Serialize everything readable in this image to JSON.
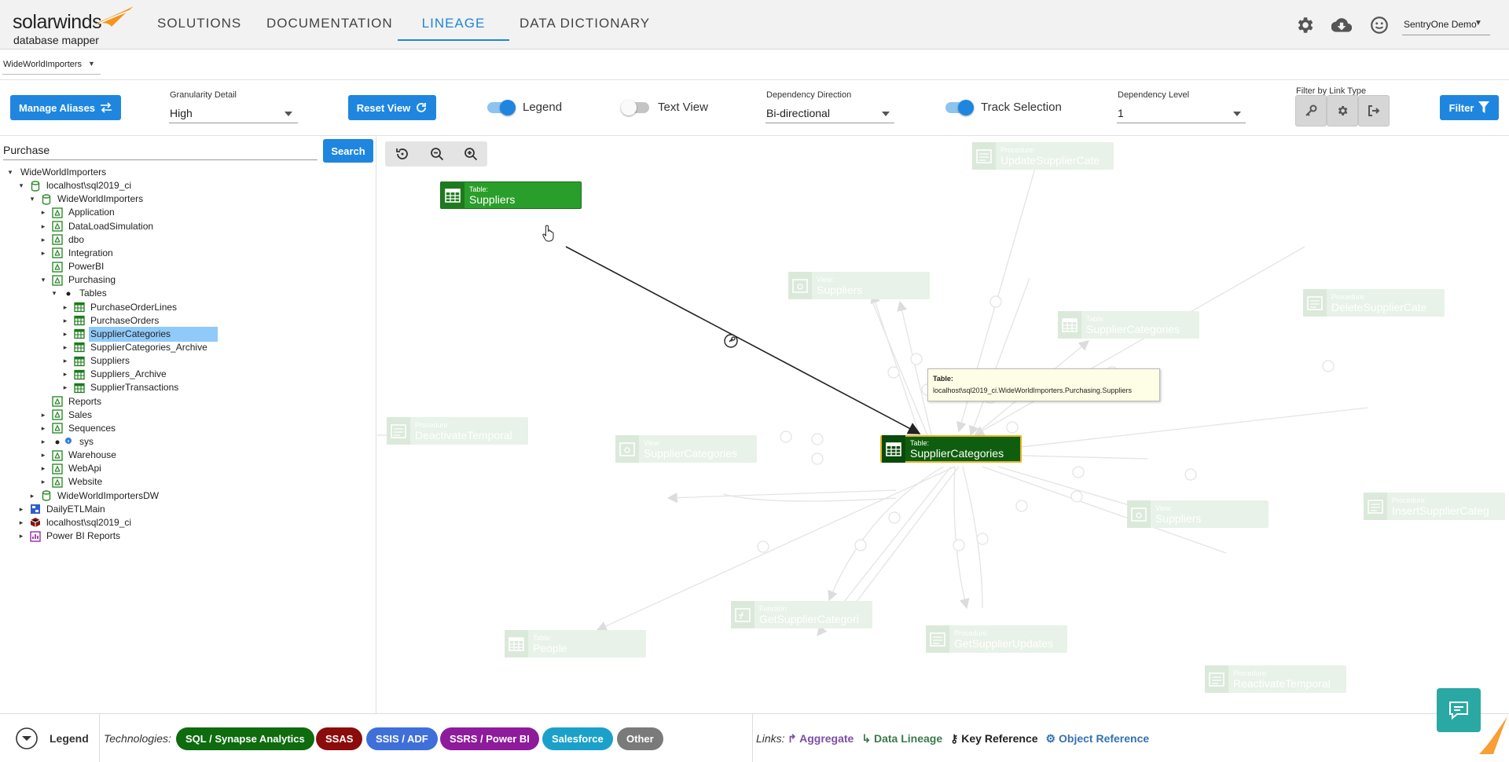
{
  "header": {
    "logo_word": "solarwinds",
    "logo_sub": "database mapper",
    "nav": [
      "SOLUTIONS",
      "DOCUMENTATION",
      "LINEAGE",
      "DATA DICTIONARY"
    ],
    "active_nav": "LINEAGE",
    "user": "SentryOne Demo",
    "icons": [
      "gear-icon",
      "cloud-download-icon",
      "smiley-icon"
    ]
  },
  "database_selector": {
    "value": "WideWorldImporters"
  },
  "toolbar": {
    "manage_aliases": "Manage Aliases",
    "granularity_label": "Granularity Detail",
    "granularity_value": "High",
    "reset_view": "Reset View",
    "legend_label": "Legend",
    "legend_on": true,
    "text_view_label": "Text View",
    "text_view_on": false,
    "dependency_direction_label": "Dependency Direction",
    "dependency_direction_value": "Bi-directional",
    "track_selection_label": "Track Selection",
    "track_selection_on": true,
    "dependency_level_label": "Dependency Level",
    "dependency_level_value": "1",
    "filter_link_type_label": "Filter by Link Type",
    "filter_button": "Filter",
    "accent_color": "#1f86e0"
  },
  "search": {
    "value": "Purchase",
    "button": "Search"
  },
  "tree": [
    {
      "label": "WideWorldImporters",
      "depth": 0,
      "toggle": "open",
      "icon": "none"
    },
    {
      "label": "localhost\\sql2019_ci",
      "depth": 1,
      "toggle": "open",
      "icon": "db-green"
    },
    {
      "label": "WideWorldImporters",
      "depth": 2,
      "toggle": "open",
      "icon": "db-green"
    },
    {
      "label": "Application",
      "depth": 3,
      "toggle": "closed",
      "icon": "schema"
    },
    {
      "label": "DataLoadSimulation",
      "depth": 3,
      "toggle": "closed",
      "icon": "schema"
    },
    {
      "label": "dbo",
      "depth": 3,
      "toggle": "closed",
      "icon": "schema"
    },
    {
      "label": "Integration",
      "depth": 3,
      "toggle": "closed",
      "icon": "schema"
    },
    {
      "label": "PowerBI",
      "depth": 3,
      "toggle": "none",
      "icon": "schema"
    },
    {
      "label": "Purchasing",
      "depth": 3,
      "toggle": "open",
      "icon": "schema"
    },
    {
      "label": "Tables",
      "depth": 4,
      "toggle": "open",
      "icon": "dot"
    },
    {
      "label": "PurchaseOrderLines",
      "depth": 5,
      "toggle": "closed",
      "icon": "table"
    },
    {
      "label": "PurchaseOrders",
      "depth": 5,
      "toggle": "closed",
      "icon": "table"
    },
    {
      "label": "SupplierCategories",
      "depth": 5,
      "toggle": "closed",
      "icon": "table",
      "selected": true
    },
    {
      "label": "SupplierCategories_Archive",
      "depth": 5,
      "toggle": "closed",
      "icon": "table"
    },
    {
      "label": "Suppliers",
      "depth": 5,
      "toggle": "closed",
      "icon": "table"
    },
    {
      "label": "Suppliers_Archive",
      "depth": 5,
      "toggle": "closed",
      "icon": "table"
    },
    {
      "label": "SupplierTransactions",
      "depth": 5,
      "toggle": "closed",
      "icon": "table"
    },
    {
      "label": "Reports",
      "depth": 3,
      "toggle": "none",
      "icon": "schema"
    },
    {
      "label": "Sales",
      "depth": 3,
      "toggle": "closed",
      "icon": "schema"
    },
    {
      "label": "Sequences",
      "depth": 3,
      "toggle": "closed",
      "icon": "schema"
    },
    {
      "label": "sys",
      "depth": 3,
      "toggle": "closed",
      "icon": "dot-info"
    },
    {
      "label": "Warehouse",
      "depth": 3,
      "toggle": "closed",
      "icon": "schema"
    },
    {
      "label": "WebApi",
      "depth": 3,
      "toggle": "closed",
      "icon": "schema"
    },
    {
      "label": "Website",
      "depth": 3,
      "toggle": "closed",
      "icon": "schema"
    },
    {
      "label": "WideWorldImportersDW",
      "depth": 2,
      "toggle": "closed",
      "icon": "db-green"
    },
    {
      "label": "DailyETLMain",
      "depth": 1,
      "toggle": "closed",
      "icon": "ssis"
    },
    {
      "label": "localhost\\sql2019_ci",
      "depth": 1,
      "toggle": "closed",
      "icon": "ssas"
    },
    {
      "label": "Power BI Reports",
      "depth": 1,
      "toggle": "closed",
      "icon": "powerbi"
    }
  ],
  "graph": {
    "nodes": [
      {
        "id": "suppliers-table",
        "kind": "Table:",
        "name": "Suppliers",
        "state": "active",
        "icon": "table"
      },
      {
        "id": "supplier-categories-table",
        "kind": "Table:",
        "name": "SupplierCategories",
        "state": "focus",
        "icon": "table"
      },
      {
        "id": "update-supplier-cat",
        "kind": "Procedure:",
        "name": "UpdateSupplierCate",
        "state": "faded",
        "icon": "proc"
      },
      {
        "id": "view-suppliers",
        "kind": "View:",
        "name": "Suppliers",
        "state": "faded",
        "icon": "view"
      },
      {
        "id": "delete-supplier-cat",
        "kind": "Procedure:",
        "name": "DeleteSupplierCate",
        "state": "faded",
        "icon": "proc"
      },
      {
        "id": "table-supplier-categories-2",
        "kind": "Table:",
        "name": "SupplierCategories",
        "state": "faded",
        "icon": "table"
      },
      {
        "id": "deactivate-temporal",
        "kind": "Procedure:",
        "name": "DeactivateTemporal",
        "state": "faded",
        "icon": "proc"
      },
      {
        "id": "view-supplier-categories",
        "kind": "View:",
        "name": "SupplierCategories",
        "state": "faded",
        "icon": "view"
      },
      {
        "id": "view-suppliers-2",
        "kind": "View:",
        "name": "Suppliers",
        "state": "faded",
        "icon": "view"
      },
      {
        "id": "insert-supplier-cat",
        "kind": "Procedure:",
        "name": "InsertSupplierCateg",
        "state": "faded",
        "icon": "proc"
      },
      {
        "id": "get-supplier-categ",
        "kind": "Function:",
        "name": "GetSupplierCategori",
        "state": "faded",
        "icon": "func"
      },
      {
        "id": "table-people",
        "kind": "Table:",
        "name": "People",
        "state": "faded",
        "icon": "table"
      },
      {
        "id": "get-supplier-updates",
        "kind": "Procedure:",
        "name": "GetSupplierUpdates",
        "state": "faded",
        "icon": "proc"
      },
      {
        "id": "reactivate-temporal",
        "kind": "Procedure:",
        "name": "ReactivateTemporal",
        "state": "faded",
        "icon": "proc"
      }
    ],
    "tooltip": {
      "title": "Table:",
      "path": "localhost\\sql2019_ci.WideWorldImporters.Purchasing.Suppliers"
    }
  },
  "legend": {
    "toggle_label": "Legend",
    "technologies_label": "Technologies:",
    "technologies": [
      {
        "label": "SQL / Synapse Analytics",
        "color": "#0e6b0e"
      },
      {
        "label": "SSAS",
        "color": "#8b0c0c"
      },
      {
        "label": "SSIS / ADF",
        "color": "#3f6fd8"
      },
      {
        "label": "SSRS / Power BI",
        "color": "#8e1b9b"
      },
      {
        "label": "Salesforce",
        "color": "#1ba1c9"
      },
      {
        "label": "Other",
        "color": "#7a7a7a"
      }
    ],
    "links_label": "Links:",
    "links": [
      {
        "label": "Aggregate",
        "color": "#7b4fa5",
        "icon": "aggregate-icon"
      },
      {
        "label": "Data Lineage",
        "color": "#3c7a4a",
        "icon": "lineage-icon"
      },
      {
        "label": "Key Reference",
        "color": "#222222",
        "icon": "key-icon"
      },
      {
        "label": "Object Reference",
        "color": "#3572b0",
        "icon": "object-ref-icon"
      }
    ]
  }
}
